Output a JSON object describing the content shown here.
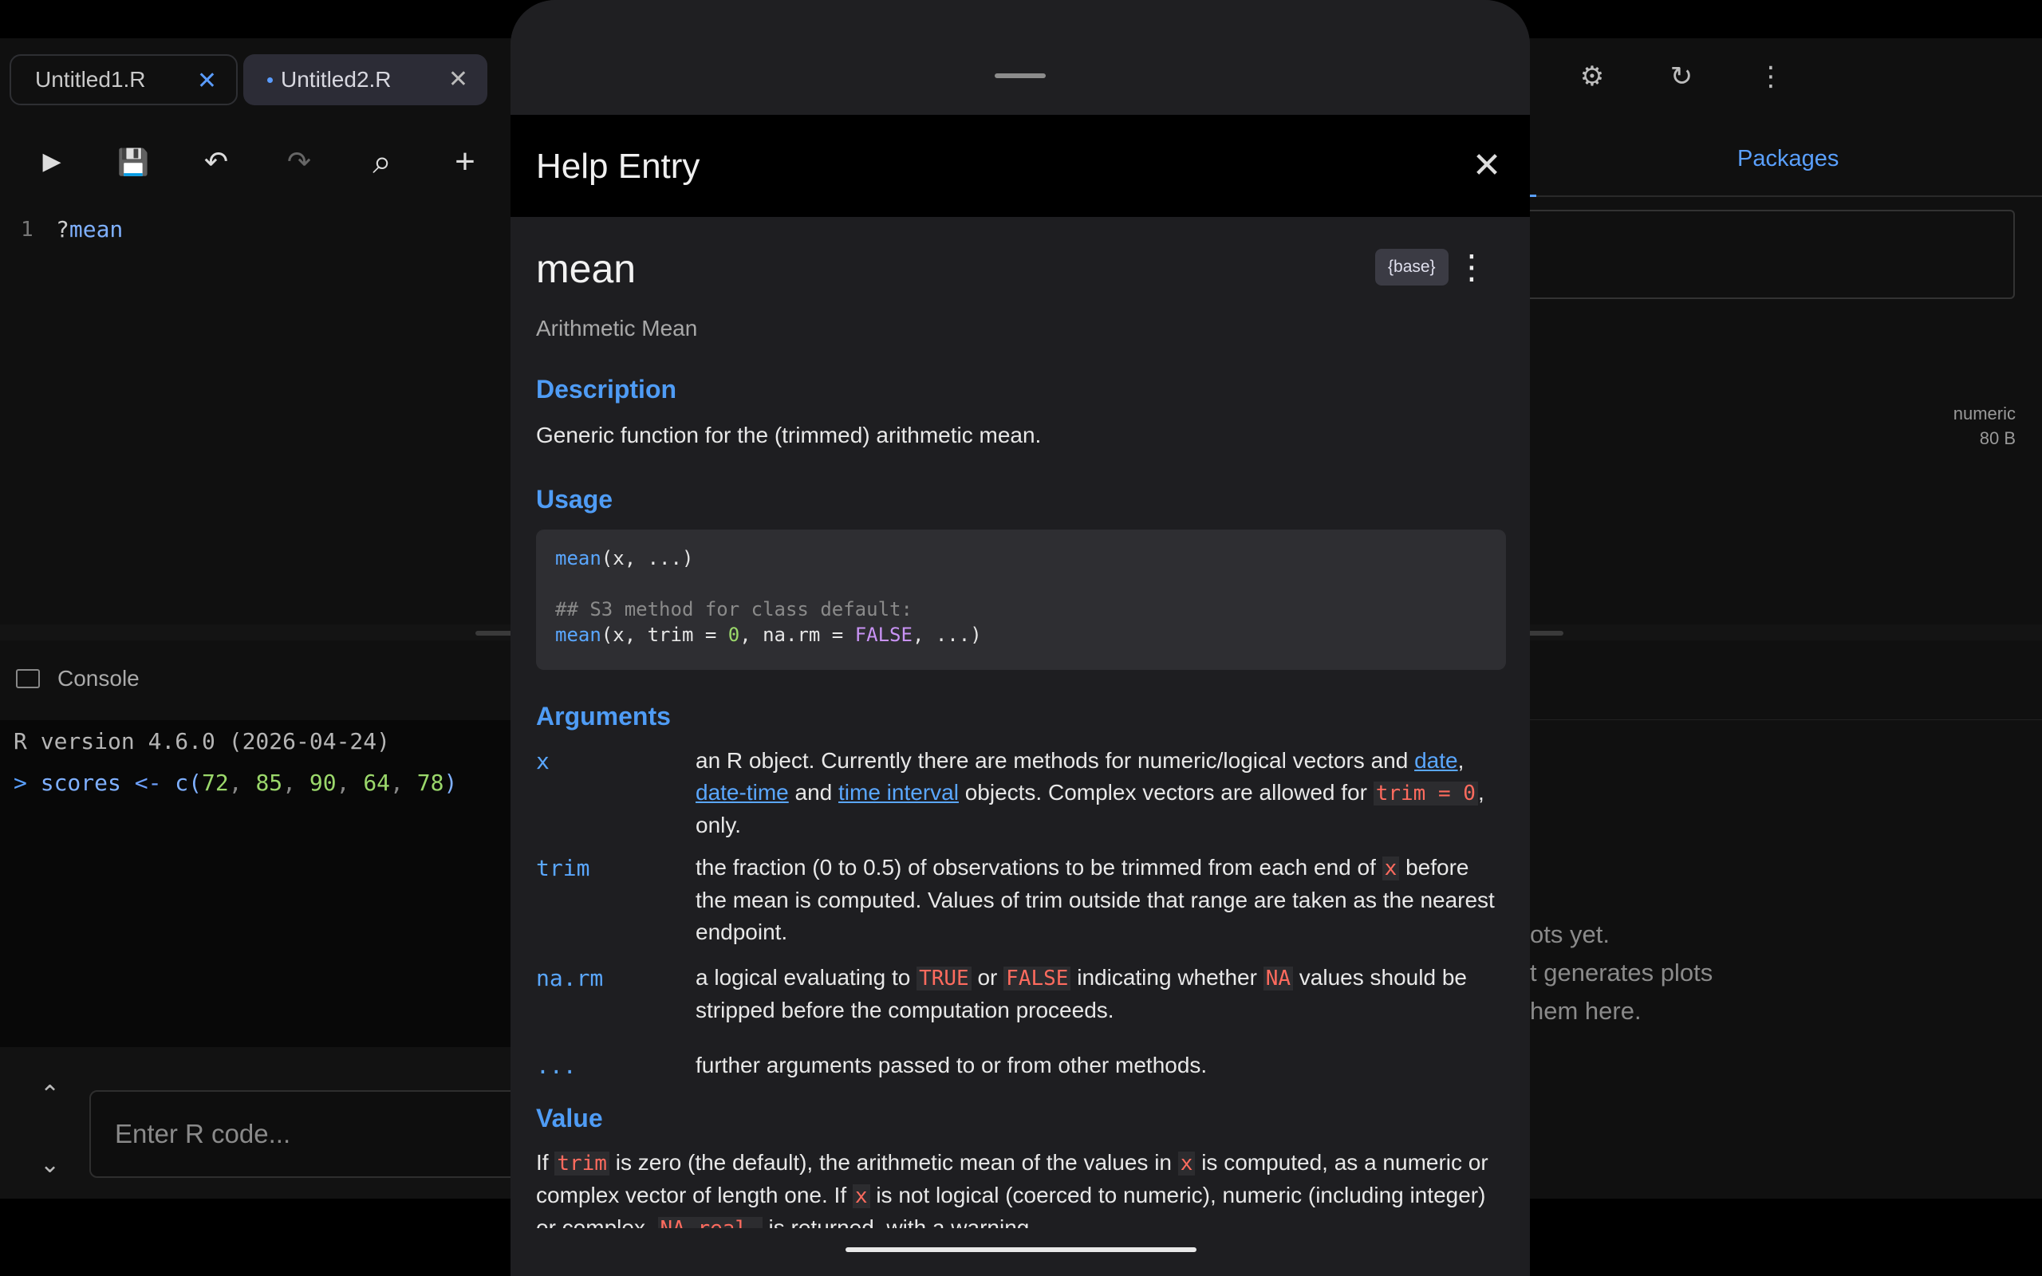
{
  "tabs": [
    {
      "label": "Untitled1.R",
      "close": "✕"
    },
    {
      "label": "Untitled2.R",
      "close": "✕"
    }
  ],
  "toolbar": {
    "run": "▶",
    "save": "💾",
    "undo": "↶",
    "redo": "↷",
    "search": "⌕",
    "add": "+"
  },
  "top_right_icons": {
    "settings": "⚙",
    "refresh": "↻",
    "more": "⋮"
  },
  "editor": {
    "line_number": "1",
    "code_prefix": "?",
    "code_ident": "mean"
  },
  "console": {
    "title": "Console",
    "lines": [
      "R version 4.6.0 (2026-04-24)",
      "> scores <- c(72, 85, 90, 64, 78)"
    ],
    "prompt": ">",
    "input_placeholder": "Enter R code...",
    "up": "⌃",
    "down": "⌄"
  },
  "right_pane": {
    "tab_label": "Packages",
    "var_type": "numeric",
    "var_size": "80 B",
    "plots_msg": [
      "ots yet.",
      "t generates plots",
      "hem here."
    ]
  },
  "sheet": {
    "title": "Help Entry",
    "close": "✕",
    "function_name": "mean",
    "package_badge": "{base}",
    "more": "⋮",
    "function_title": "Arithmetic Mean",
    "sections": {
      "description": "Description",
      "usage": "Usage",
      "arguments": "Arguments",
      "value": "Value"
    },
    "description_text": "Generic function for the (trimmed) arithmetic mean.",
    "usage": {
      "line1_fn": "mean",
      "line1_rest": "(x, ...)",
      "comment": "## S3 method for class default:",
      "line3_fn": "mean",
      "line3_a": "(x, trim = ",
      "line3_num": "0",
      "line3_b": ", na.rm = ",
      "line3_bool": "FALSE",
      "line3_c": ", ...)"
    },
    "arguments": [
      {
        "name": "x",
        "t1": "an R object. Currently there are methods for numeric/logical vectors and ",
        "link1": "date",
        "t2": ", ",
        "link2": "date-time",
        "t3": " and ",
        "link3": "time interval",
        "t4": " objects. Complex vectors are allowed for ",
        "code1": "trim = 0",
        "t5": ", only."
      },
      {
        "name": "trim",
        "t1": "the fraction (0 to 0.5) of observations to be trimmed from each end of ",
        "code1": "x",
        "t2": " before the mean is computed. Values of trim outside that range are taken as the nearest endpoint."
      },
      {
        "name": "na.rm",
        "t1": "a logical evaluating to ",
        "code1": "TRUE",
        "t2": " or ",
        "code2": "FALSE",
        "t3": " indicating whether ",
        "code3": "NA",
        "t4": " values should be stripped before the computation proceeds."
      },
      {
        "name": "...",
        "t1": "further arguments passed to or from other methods."
      }
    ],
    "value": {
      "t1": "If ",
      "code1": "trim",
      "t2": " is zero (the default), the arithmetic mean of the values in ",
      "code2": "x",
      "t3": " is computed, as a numeric or complex vector of length one. If ",
      "code3": "x",
      "t4": " is not logical (coerced to numeric), numeric (including integer) or complex, ",
      "code4": "NA_real_",
      "t5": " is returned, with a warning."
    }
  },
  "colors": {
    "accent": "#4f9cf5",
    "inline_code": "#ff6b5e",
    "sheet_bg": "#1e1e21"
  }
}
